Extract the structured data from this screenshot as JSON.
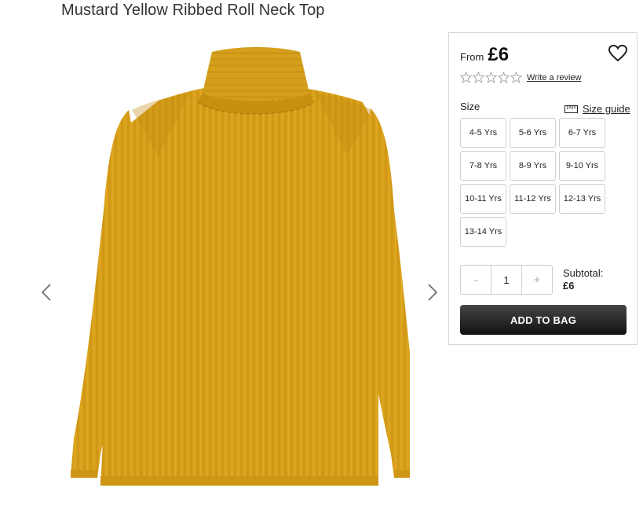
{
  "product": {
    "title": "Mustard Yellow Ribbed Roll Neck Top",
    "image_icon": "mustard-roll-neck-top-image"
  },
  "gallery": {
    "prev_icon": "chevron-left-icon",
    "next_icon": "chevron-right-icon"
  },
  "pricing": {
    "from_label": "From",
    "price": "£6"
  },
  "rating": {
    "stars_filled": 0,
    "stars_total": 5,
    "write_review": "Write a review"
  },
  "size": {
    "label": "Size",
    "guide_label": "Size guide",
    "options": [
      "4-5 Yrs",
      "5-6 Yrs",
      "6-7 Yrs",
      "7-8 Yrs",
      "8-9 Yrs",
      "9-10 Yrs",
      "10-11 Yrs",
      "11-12 Yrs",
      "12-13 Yrs",
      "13-14 Yrs"
    ]
  },
  "quantity": {
    "minus": "-",
    "value": "1",
    "plus": "+"
  },
  "subtotal": {
    "label": "Subtotal:",
    "value": "£6"
  },
  "actions": {
    "add_to_bag": "ADD TO BAG"
  },
  "colors": {
    "product_yellow": "#d9a11b",
    "button_dark": "#1a1a1a"
  }
}
